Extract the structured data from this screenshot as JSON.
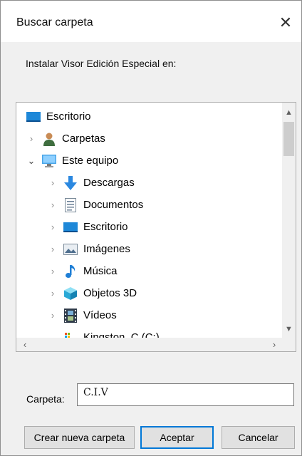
{
  "dialog": {
    "title": "Buscar carpeta",
    "close_glyph": "✕",
    "instruction": "Instalar Visor Edición Especial en:"
  },
  "tree": {
    "items": [
      {
        "label": "Escritorio",
        "icon": "desktop-icon",
        "expander": ""
      },
      {
        "label": "Carpetas",
        "icon": "user-icon",
        "expander": "collapsed"
      },
      {
        "label": "Este equipo",
        "icon": "computer-icon",
        "expander": "expanded"
      },
      {
        "label": "Descargas",
        "icon": "download-icon",
        "expander": "collapsed"
      },
      {
        "label": "Documentos",
        "icon": "document-icon",
        "expander": "collapsed"
      },
      {
        "label": "Escritorio",
        "icon": "desktop-icon",
        "expander": "collapsed"
      },
      {
        "label": "Imágenes",
        "icon": "pictures-icon",
        "expander": "collapsed"
      },
      {
        "label": "Música",
        "icon": "music-icon",
        "expander": "collapsed"
      },
      {
        "label": "Objetos 3D",
        "icon": "cube-icon",
        "expander": "collapsed"
      },
      {
        "label": "Vídeos",
        "icon": "video-icon",
        "expander": "collapsed"
      },
      {
        "label": "Kingston_C (C:)",
        "icon": "drive-icon",
        "expander": "expanded"
      }
    ]
  },
  "folder": {
    "label": "Carpeta:",
    "value": "C.I.V"
  },
  "buttons": {
    "new_folder": "Crear nueva carpeta",
    "ok": "Aceptar",
    "cancel": "Cancelar"
  },
  "colors": {
    "accent": "#0078d7",
    "dialog_bg": "#f0f0f0"
  }
}
